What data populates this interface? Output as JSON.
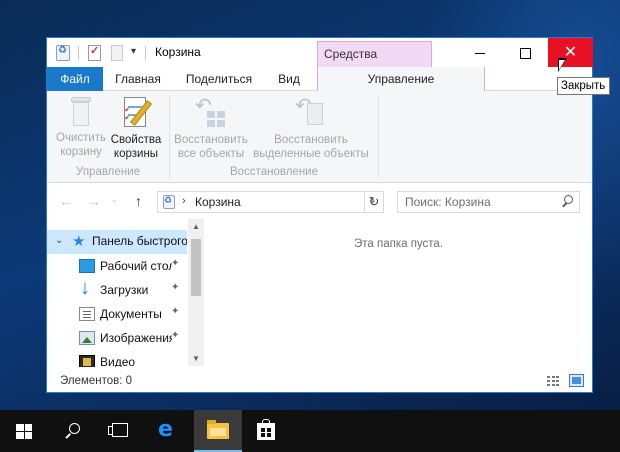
{
  "window": {
    "title": "Корзина",
    "context_tab_header": "Средства работы...",
    "close_tooltip": "Закрыть",
    "close_glyph": "✕",
    "help_glyph": "?"
  },
  "quick_access_toolbar": {
    "dropdown_glyph": "▾",
    "icons": [
      "recycle-bin-icon",
      "properties-icon",
      "new-folder-icon"
    ]
  },
  "ribbon": {
    "tabs": [
      {
        "label": "Файл"
      },
      {
        "label": "Главная"
      },
      {
        "label": "Поделиться"
      },
      {
        "label": "Вид"
      },
      {
        "label": "Управление"
      }
    ],
    "buttons": {
      "empty_bin": "Очистить корзину",
      "properties": "Свойства корзины",
      "restore_all": "Восстановить все объекты",
      "restore_selected": "Восстановить выделенные объекты"
    },
    "groups": {
      "manage": "Управление",
      "restore": "Восстановление"
    }
  },
  "navigation": {
    "back_glyph": "←",
    "forward_glyph": "→",
    "recent_glyph": "⌄",
    "up_glyph": "↑",
    "address_separator": "›",
    "address_path": "Корзина",
    "address_dropdown_glyph": "⌄",
    "refresh_glyph": "↻",
    "search_placeholder": "Поиск: Корзина"
  },
  "nav_pane": {
    "expander_glyph": "⌄",
    "pin_glyph": "📌",
    "items": [
      {
        "label": "Панель быстрого доступа",
        "icon": "star-icon",
        "selected": true
      },
      {
        "label": "Рабочий стол",
        "icon": "desktop-icon",
        "pinned": true
      },
      {
        "label": "Загрузки",
        "icon": "downloads-icon",
        "pinned": true
      },
      {
        "label": "Документы",
        "icon": "documents-icon",
        "pinned": true
      },
      {
        "label": "Изображения",
        "icon": "pictures-icon",
        "pinned": true
      },
      {
        "label": "Видео",
        "icon": "videos-icon",
        "pinned": false
      }
    ],
    "scroll_up_glyph": "▲",
    "scroll_down_glyph": "▼"
  },
  "content": {
    "empty_message": "Эта папка пуста."
  },
  "status_bar": {
    "item_count": "Элементов: 0"
  },
  "taskbar": {
    "items": [
      "start-icon",
      "search-icon",
      "task-view-icon",
      "edge-icon",
      "file-explorer-icon",
      "store-icon"
    ],
    "edge_glyph": "e"
  },
  "colors": {
    "file_tab": "#1979ca",
    "close_button": "#e81123",
    "context_tab": "#f2d9f4",
    "selection": "#cce8ff"
  }
}
